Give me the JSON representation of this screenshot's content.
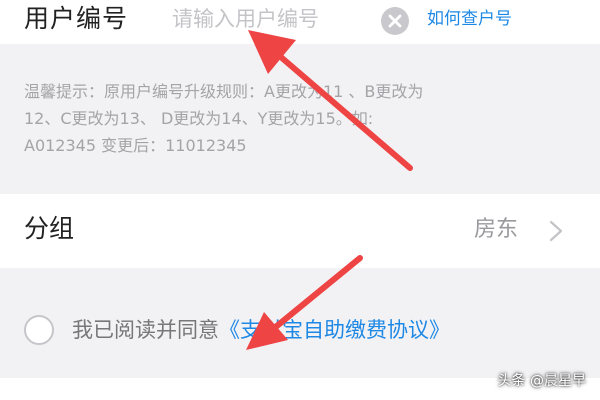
{
  "account": {
    "label": "用户编号",
    "input_value": "",
    "placeholder": "请输入用户编号",
    "help_link": "如何查户号",
    "clear_icon": "clear-circle-icon"
  },
  "tip": {
    "lines": [
      "温馨提示：原用户编号升级规则：A更改为11 、B更改为",
      "12、C更改为13、 D更改为14、Y更改为15。如:",
      "A012345 变更后：11012345"
    ]
  },
  "group": {
    "label": "分组",
    "value": "房东",
    "chevron_icon": "chevron-right-icon"
  },
  "agreement": {
    "prefix": "我已阅读并同意",
    "link_text": "《支付宝自助缴费协议》",
    "checked": false
  },
  "watermark": {
    "text": "头条 @晨星早"
  },
  "colors": {
    "accent": "#1e88e5",
    "arrow": "#ee4444",
    "background": "#f2f2f5"
  }
}
